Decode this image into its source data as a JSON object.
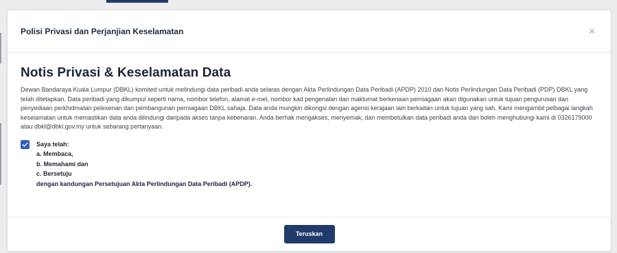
{
  "modal": {
    "title": "Polisi Privasi dan Perjanjian Keselamatan",
    "close_icon": "close-icon"
  },
  "notice": {
    "heading": "Notis Privasi & Keselamatan Data",
    "body": "Dewan Bandaraya Kuala Lumpur (DBKL) komited untuk melindungi data peribadi anda selaras dengan Akta Perlindungan Data Peribadi (APDP) 2010 dan Notis Perlindungan Data Peribadi (PDP) DBKL yang telah ditetapkan. Data peribadi yang dikumpul seperti nama, nombor telefon, alamat e-mel, nombor kad pengenalan dan maklumat berkenaan perniagaan akan digunakan untuk tujuan pengurusan dan penyediaan perkhidmatan pelesenan dan pembangunan perniagaan DBKL sahaja. Data anda mungkin dikongsi dengan agensi kerajaan lain berkaitan untuk tujuan yang sah. Kami mengambil pelbagai langkah keselamatan untuk memastikan data anda dilindungi daripada akses tanpa kebenaran. Anda berhak mengakses, menyemak, dan membetulkan data peribadi anda dan boleh menghubungi kami di 0326179000 atau dbkl@dbkl.gov.my untuk sebarang pertanyaan."
  },
  "consent": {
    "checked": true,
    "lines": [
      "Saya telah:",
      "a. Membaca,",
      "b. Memahami dan",
      "c. Bersetuju",
      "dengan kandungan Persetujuan Akta Perlindungan Data Peribadi (APDP)."
    ]
  },
  "footer": {
    "continue_label": "Teruskan"
  },
  "colors": {
    "primary": "#203a6b",
    "checkbox": "#2e5cb8"
  }
}
